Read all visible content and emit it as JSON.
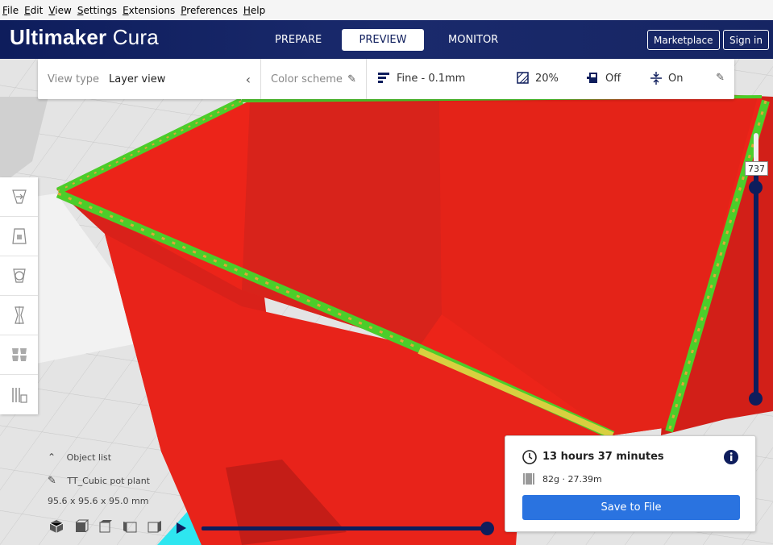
{
  "menu": [
    "File",
    "Edit",
    "View",
    "Settings",
    "Extensions",
    "Preferences",
    "Help"
  ],
  "header": {
    "logo_bold": "Ultimaker",
    "logo_light": "Cura",
    "tabs": [
      {
        "label": "PREPARE",
        "active": false
      },
      {
        "label": "PREVIEW",
        "active": true
      },
      {
        "label": "MONITOR",
        "active": false
      }
    ],
    "marketplace_label": "Marketplace",
    "signin_label": "Sign in"
  },
  "viewbar": {
    "view_type_label": "View type",
    "view_type_value": "Layer view",
    "color_scheme_label": "Color scheme",
    "profile": "Fine - 0.1mm",
    "infill": "20%",
    "support": "Off",
    "adhesion": "On"
  },
  "layer_slider": {
    "current_layer": "737"
  },
  "object_list": {
    "title": "Object list",
    "object_name": "TT_Cubic pot plant",
    "dimensions": "95.6 x 95.6 x 95.0 mm"
  },
  "print_info": {
    "time": "13 hours 37 minutes",
    "material": "82g · 27.39m",
    "save_label": "Save to File"
  },
  "colors": {
    "header_bg": "#0e1d5c",
    "accent_blue": "#2a73e0",
    "model_red": "#e8231a",
    "infill_green": "#4ccd2a",
    "support_cyan": "#2ee6f0"
  }
}
